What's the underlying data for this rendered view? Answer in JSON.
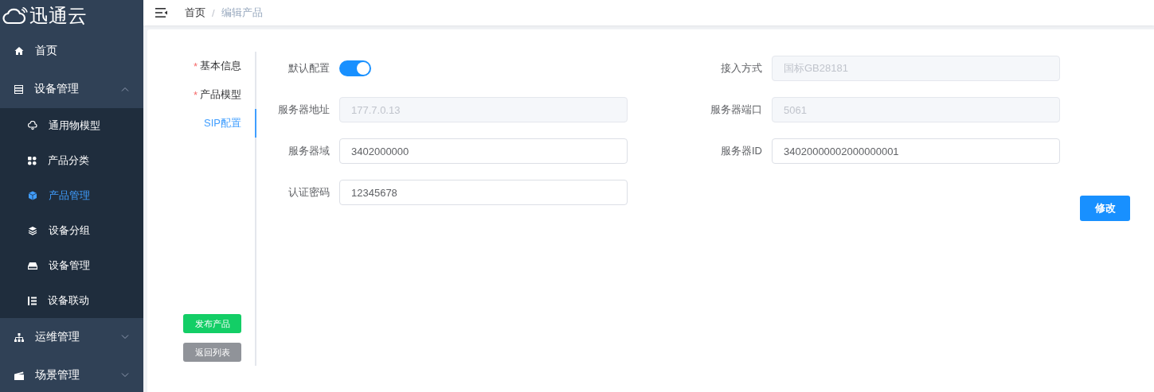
{
  "sidebar": {
    "logo": "迅通云",
    "items": [
      {
        "label": "首页",
        "kind": "link"
      },
      {
        "label": "设备管理",
        "kind": "group",
        "expanded": true,
        "children": [
          {
            "label": "通用物模型",
            "selected": false
          },
          {
            "label": "产品分类",
            "selected": false
          },
          {
            "label": "产品管理",
            "selected": true
          },
          {
            "label": "设备分组",
            "selected": false
          },
          {
            "label": "设备管理",
            "selected": false
          },
          {
            "label": "设备联动",
            "selected": false
          }
        ]
      },
      {
        "label": "运维管理",
        "kind": "group",
        "expanded": false
      },
      {
        "label": "场景管理",
        "kind": "group",
        "expanded": false
      }
    ]
  },
  "breadcrumb": {
    "separator": "/",
    "items": [
      {
        "label": "首页",
        "current": false
      },
      {
        "label": "编辑产品",
        "current": true
      }
    ]
  },
  "required_mark": "*",
  "steps": [
    {
      "label": "基本信息",
      "required": true,
      "selected": false
    },
    {
      "label": "产品模型",
      "required": true,
      "selected": false
    },
    {
      "label": "SIP配置",
      "required": false,
      "selected": true
    }
  ],
  "step_buttons": [
    {
      "label": "发布产品",
      "kind": "success"
    },
    {
      "label": "返回列表",
      "kind": "info"
    }
  ],
  "form": {
    "columns": [
      [
        {
          "label": "默认配置",
          "kind": "switch",
          "on": true
        },
        {
          "label": "服务器地址",
          "kind": "input",
          "value": "177.7.0.13",
          "disabled": true
        },
        {
          "label": "服务器域",
          "kind": "input",
          "value": "3402000000",
          "disabled": false
        },
        {
          "label": "认证密码",
          "kind": "input",
          "value": "12345678",
          "disabled": false
        }
      ],
      [
        {
          "label": "接入方式",
          "kind": "input",
          "value": "国标GB28181",
          "disabled": true
        },
        {
          "label": "服务器端口",
          "kind": "input",
          "value": "5061",
          "disabled": true
        },
        {
          "label": "服务器ID",
          "kind": "input",
          "value": "34020000002000000001",
          "disabled": false
        }
      ]
    ],
    "submit": "修改"
  }
}
